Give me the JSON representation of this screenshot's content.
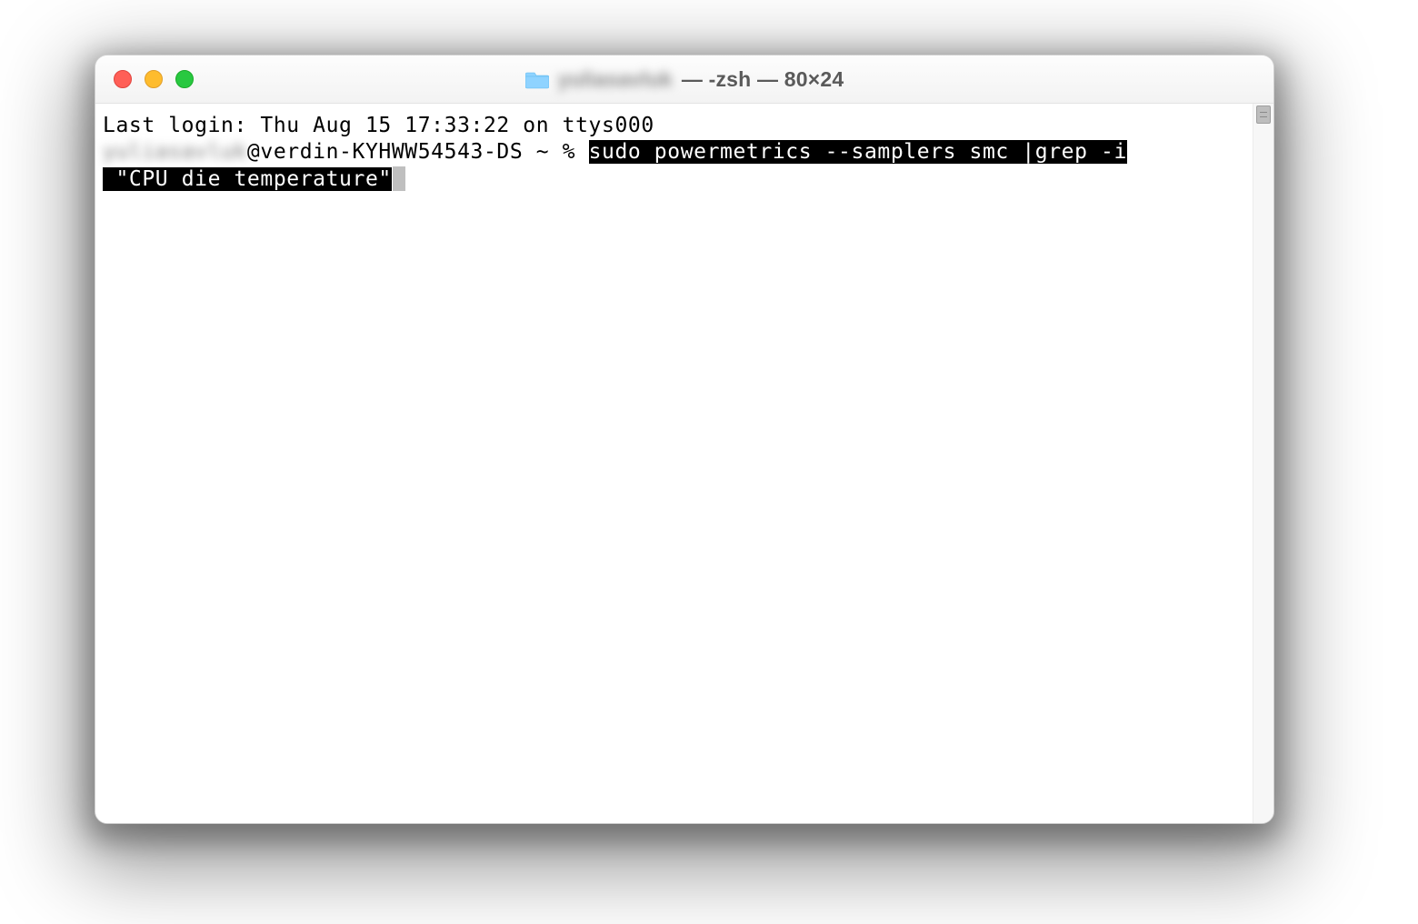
{
  "titlebar": {
    "folder_name_blurred": "yuliasavluk",
    "title_suffix": " — -zsh — 80×24"
  },
  "terminal": {
    "last_login_line": "Last login: Thu Aug 15 17:33:22 on ttys000",
    "prompt_user_blurred": "yuliasavluk",
    "prompt_host_segment": "@verdin-KYHWW54543-DS ~ % ",
    "command_selected_part1": "sudo powermetrics --samplers smc |grep -i",
    "command_selected_part2": " \"CPU die temperature\""
  }
}
